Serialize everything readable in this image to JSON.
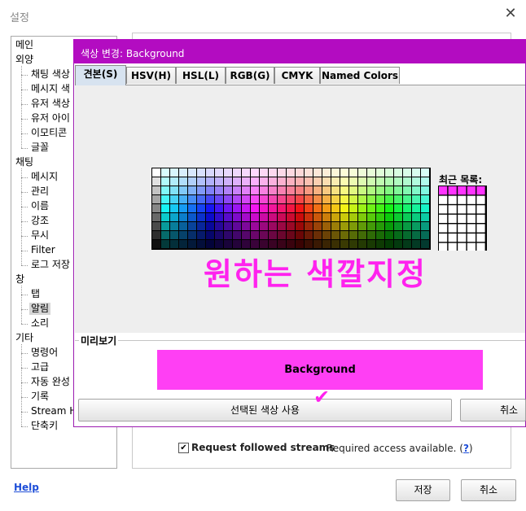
{
  "settings": {
    "title": "설정",
    "close_icon": "close-icon",
    "tree": [
      {
        "label": "메인",
        "level": 0
      },
      {
        "label": "외양",
        "level": 0
      },
      {
        "label": "채팅 색상",
        "level": 1
      },
      {
        "label": "메시지 색",
        "level": 1
      },
      {
        "label": "유저 색상",
        "level": 1
      },
      {
        "label": "유저 아이",
        "level": 1
      },
      {
        "label": "이모티콘",
        "level": 1
      },
      {
        "label": "글꼴",
        "level": 1
      },
      {
        "label": "채팅",
        "level": 0
      },
      {
        "label": "메시지",
        "level": 1
      },
      {
        "label": "관리",
        "level": 1
      },
      {
        "label": "이름",
        "level": 1
      },
      {
        "label": "강조",
        "level": 1
      },
      {
        "label": "무시",
        "level": 1
      },
      {
        "label": "Filter",
        "level": 1
      },
      {
        "label": "로그 저장",
        "level": 1
      },
      {
        "label": "창",
        "level": 0
      },
      {
        "label": "탭",
        "level": 1
      },
      {
        "label": "알림",
        "level": 1,
        "selected": true
      },
      {
        "label": "소리",
        "level": 1
      },
      {
        "label": "기타",
        "level": 0
      },
      {
        "label": "명령어",
        "level": 1
      },
      {
        "label": "고급",
        "level": 1
      },
      {
        "label": "자동 완성",
        "level": 1
      },
      {
        "label": "기록",
        "level": 1
      },
      {
        "label": "Stream H",
        "level": 1
      },
      {
        "label": "단축키",
        "level": 1
      }
    ],
    "follow_streams_label": "Request followed streams",
    "follow_streams_checked": "✔",
    "access_text": "Required access available. (",
    "access_link": "?",
    "access_close": ")",
    "help_label": "Help",
    "save_label": "저장",
    "cancel_label": "취소"
  },
  "dialog": {
    "title": "색상 변경: Background",
    "tabs": [
      {
        "label": "견본(S)",
        "active": true
      },
      {
        "label": "HSV(H)"
      },
      {
        "label": "HSL(L)"
      },
      {
        "label": "RGB(G)"
      },
      {
        "label": "CMYK"
      },
      {
        "label": "Named Colors"
      }
    ],
    "recent_label": "최근 목록:",
    "annotation": "원하는 색깔지정",
    "preview_label": "미리보기",
    "preview_text": "Background",
    "use_selected_label": "선택된 색상 사용",
    "cancel_label": "취소",
    "checkmark": "✔",
    "recent_colors": [
      "#ff33ff",
      "#ff33ff",
      "#ff33ff",
      "#ff33ff",
      "#ff33ff"
    ],
    "preview_color": "#ff3ff4",
    "accent_color": "#b30cc1"
  }
}
